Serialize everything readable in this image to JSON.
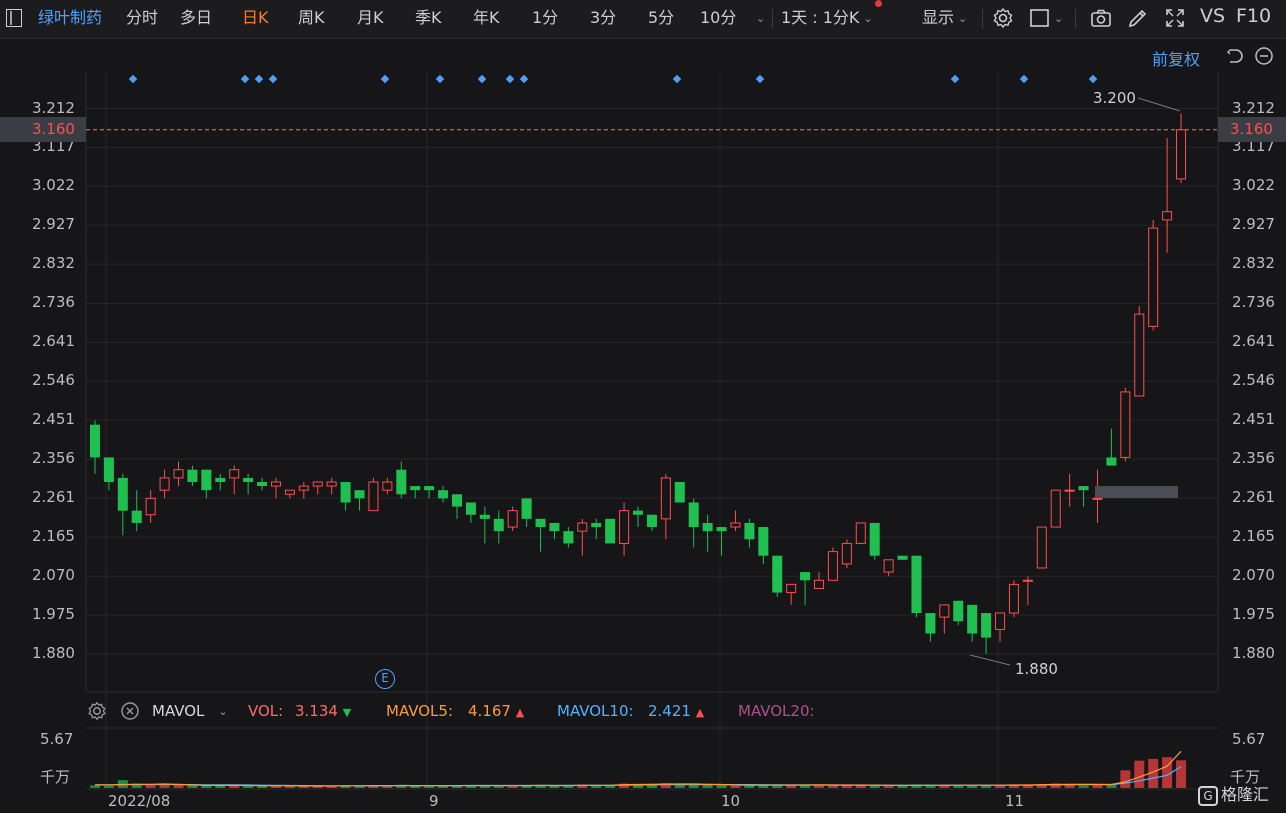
{
  "toolbar": {
    "stock_name": "绿叶制药",
    "tabs": [
      "分时",
      "多日",
      "日K",
      "周K",
      "月K",
      "季K",
      "年K",
      "1分",
      "3分",
      "5分",
      "10分"
    ],
    "active_tab": "日K",
    "period_select": "1天 : 1分K",
    "display_label": "显示",
    "vs_label": "VS",
    "f10_label": "F10",
    "adjust_label": "前复权"
  },
  "price_axis": {
    "ticks": [
      "3.212",
      "3.117",
      "3.022",
      "2.927",
      "2.832",
      "2.736",
      "2.641",
      "2.546",
      "2.451",
      "2.356",
      "2.261",
      "2.165",
      "2.070",
      "1.975",
      "1.880"
    ],
    "current_price": "3.160",
    "high_label": "3.200",
    "low_label": "1.880"
  },
  "volume_indicator": {
    "name": "MAVOL",
    "vol_label": "VOL:",
    "vol_value": "3.134",
    "ma5_label": "MAVOL5:",
    "ma5_value": "4.167",
    "ma10_label": "MAVOL10:",
    "ma10_value": "2.421",
    "ma20_label": "MAVOL20:",
    "axis_top": "5.67",
    "axis_unit": "千万"
  },
  "x_axis": {
    "labels": [
      "2022/08",
      "9",
      "10",
      "11"
    ]
  },
  "event_marker": "E",
  "watermark": "格隆汇",
  "colors": {
    "up": "#ff4d4d",
    "down": "#1fbf50",
    "accent": "#ff7a2f",
    "link": "#4ea0ff",
    "ma5": "#ff9a3c",
    "ma10": "#4fb3ff",
    "ma20": "#b0508a",
    "current_price_line": "#ff7a2f"
  },
  "chart_data": {
    "type": "candlestick",
    "ylim": [
      1.84,
      3.26
    ],
    "candles": [
      {
        "o": 2.44,
        "h": 2.45,
        "l": 2.32,
        "c": 2.36
      },
      {
        "o": 2.36,
        "h": 2.36,
        "l": 2.28,
        "c": 2.3
      },
      {
        "o": 2.31,
        "h": 2.32,
        "l": 2.17,
        "c": 2.23
      },
      {
        "o": 2.23,
        "h": 2.28,
        "l": 2.18,
        "c": 2.2
      },
      {
        "o": 2.22,
        "h": 2.28,
        "l": 2.2,
        "c": 2.26
      },
      {
        "o": 2.28,
        "h": 2.33,
        "l": 2.26,
        "c": 2.31
      },
      {
        "o": 2.31,
        "h": 2.35,
        "l": 2.29,
        "c": 2.33
      },
      {
        "o": 2.33,
        "h": 2.34,
        "l": 2.29,
        "c": 2.3
      },
      {
        "o": 2.33,
        "h": 2.33,
        "l": 2.26,
        "c": 2.28
      },
      {
        "o": 2.31,
        "h": 2.32,
        "l": 2.28,
        "c": 2.3
      },
      {
        "o": 2.31,
        "h": 2.34,
        "l": 2.27,
        "c": 2.33
      },
      {
        "o": 2.31,
        "h": 2.32,
        "l": 2.27,
        "c": 2.3
      },
      {
        "o": 2.3,
        "h": 2.31,
        "l": 2.28,
        "c": 2.29
      },
      {
        "o": 2.29,
        "h": 2.31,
        "l": 2.26,
        "c": 2.3
      },
      {
        "o": 2.27,
        "h": 2.28,
        "l": 2.26,
        "c": 2.28
      },
      {
        "o": 2.28,
        "h": 2.3,
        "l": 2.26,
        "c": 2.29
      },
      {
        "o": 2.29,
        "h": 2.3,
        "l": 2.27,
        "c": 2.3
      },
      {
        "o": 2.29,
        "h": 2.31,
        "l": 2.27,
        "c": 2.3
      },
      {
        "o": 2.3,
        "h": 2.3,
        "l": 2.23,
        "c": 2.25
      },
      {
        "o": 2.28,
        "h": 2.28,
        "l": 2.23,
        "c": 2.26
      },
      {
        "o": 2.23,
        "h": 2.31,
        "l": 2.23,
        "c": 2.3
      },
      {
        "o": 2.28,
        "h": 2.31,
        "l": 2.27,
        "c": 2.3
      },
      {
        "o": 2.33,
        "h": 2.35,
        "l": 2.26,
        "c": 2.27
      },
      {
        "o": 2.29,
        "h": 2.29,
        "l": 2.26,
        "c": 2.28
      },
      {
        "o": 2.29,
        "h": 2.29,
        "l": 2.26,
        "c": 2.28
      },
      {
        "o": 2.28,
        "h": 2.29,
        "l": 2.25,
        "c": 2.26
      },
      {
        "o": 2.27,
        "h": 2.27,
        "l": 2.21,
        "c": 2.24
      },
      {
        "o": 2.25,
        "h": 2.25,
        "l": 2.2,
        "c": 2.22
      },
      {
        "o": 2.22,
        "h": 2.24,
        "l": 2.15,
        "c": 2.21
      },
      {
        "o": 2.21,
        "h": 2.23,
        "l": 2.15,
        "c": 2.18
      },
      {
        "o": 2.19,
        "h": 2.24,
        "l": 2.18,
        "c": 2.23
      },
      {
        "o": 2.26,
        "h": 2.26,
        "l": 2.19,
        "c": 2.21
      },
      {
        "o": 2.21,
        "h": 2.21,
        "l": 2.13,
        "c": 2.19
      },
      {
        "o": 2.2,
        "h": 2.2,
        "l": 2.16,
        "c": 2.18
      },
      {
        "o": 2.18,
        "h": 2.19,
        "l": 2.14,
        "c": 2.15
      },
      {
        "o": 2.18,
        "h": 2.21,
        "l": 2.12,
        "c": 2.2
      },
      {
        "o": 2.2,
        "h": 2.21,
        "l": 2.16,
        "c": 2.19
      },
      {
        "o": 2.21,
        "h": 2.21,
        "l": 2.15,
        "c": 2.15
      },
      {
        "o": 2.15,
        "h": 2.25,
        "l": 2.12,
        "c": 2.23
      },
      {
        "o": 2.23,
        "h": 2.24,
        "l": 2.19,
        "c": 2.22
      },
      {
        "o": 2.22,
        "h": 2.22,
        "l": 2.18,
        "c": 2.19
      },
      {
        "o": 2.21,
        "h": 2.32,
        "l": 2.16,
        "c": 2.31
      },
      {
        "o": 2.3,
        "h": 2.3,
        "l": 2.25,
        "c": 2.25
      },
      {
        "o": 2.25,
        "h": 2.26,
        "l": 2.14,
        "c": 2.19
      },
      {
        "o": 2.2,
        "h": 2.22,
        "l": 2.13,
        "c": 2.18
      },
      {
        "o": 2.19,
        "h": 2.19,
        "l": 2.12,
        "c": 2.18
      },
      {
        "o": 2.19,
        "h": 2.23,
        "l": 2.18,
        "c": 2.2
      },
      {
        "o": 2.2,
        "h": 2.21,
        "l": 2.14,
        "c": 2.16
      },
      {
        "o": 2.19,
        "h": 2.19,
        "l": 2.1,
        "c": 2.12
      },
      {
        "o": 2.12,
        "h": 2.12,
        "l": 2.02,
        "c": 2.03
      },
      {
        "o": 2.03,
        "h": 2.05,
        "l": 2.0,
        "c": 2.05
      },
      {
        "o": 2.08,
        "h": 2.08,
        "l": 2.0,
        "c": 2.06
      },
      {
        "o": 2.04,
        "h": 2.08,
        "l": 2.04,
        "c": 2.06
      },
      {
        "o": 2.06,
        "h": 2.14,
        "l": 2.06,
        "c": 2.13
      },
      {
        "o": 2.1,
        "h": 2.16,
        "l": 2.09,
        "c": 2.15
      },
      {
        "o": 2.15,
        "h": 2.2,
        "l": 2.15,
        "c": 2.2
      },
      {
        "o": 2.2,
        "h": 2.2,
        "l": 2.11,
        "c": 2.12
      },
      {
        "o": 2.08,
        "h": 2.11,
        "l": 2.07,
        "c": 2.11
      },
      {
        "o": 2.12,
        "h": 2.12,
        "l": 2.11,
        "c": 2.11
      },
      {
        "o": 2.12,
        "h": 2.12,
        "l": 1.97,
        "c": 1.98
      },
      {
        "o": 1.98,
        "h": 1.98,
        "l": 1.91,
        "c": 1.93
      },
      {
        "o": 1.97,
        "h": 2.0,
        "l": 1.93,
        "c": 2.0
      },
      {
        "o": 2.01,
        "h": 2.01,
        "l": 1.95,
        "c": 1.96
      },
      {
        "o": 2.0,
        "h": 2.0,
        "l": 1.91,
        "c": 1.93
      },
      {
        "o": 1.98,
        "h": 1.98,
        "l": 1.88,
        "c": 1.92
      },
      {
        "o": 1.94,
        "h": 1.98,
        "l": 1.91,
        "c": 1.98
      },
      {
        "o": 1.98,
        "h": 2.06,
        "l": 1.97,
        "c": 2.05
      },
      {
        "o": 2.06,
        "h": 2.07,
        "l": 2.0,
        "c": 2.06
      },
      {
        "o": 2.09,
        "h": 2.19,
        "l": 2.09,
        "c": 2.19
      },
      {
        "o": 2.19,
        "h": 2.28,
        "l": 2.19,
        "c": 2.28
      },
      {
        "o": 2.28,
        "h": 2.32,
        "l": 2.24,
        "c": 2.28
      },
      {
        "o": 2.29,
        "h": 2.29,
        "l": 2.24,
        "c": 2.28
      },
      {
        "o": 2.26,
        "h": 2.33,
        "l": 2.2,
        "c": 2.26
      },
      {
        "o": 2.36,
        "h": 2.43,
        "l": 2.35,
        "c": 2.34
      },
      {
        "o": 2.36,
        "h": 2.53,
        "l": 2.35,
        "c": 2.52
      },
      {
        "o": 2.51,
        "h": 2.73,
        "l": 2.51,
        "c": 2.71
      },
      {
        "o": 2.68,
        "h": 2.94,
        "l": 2.67,
        "c": 2.92
      },
      {
        "o": 2.94,
        "h": 3.14,
        "l": 2.86,
        "c": 2.96
      },
      {
        "o": 3.04,
        "h": 3.2,
        "l": 3.03,
        "c": 3.16
      }
    ],
    "volume": {
      "ylim": [
        0,
        5.67
      ],
      "unit": "千万",
      "values": [
        0.3,
        0.25,
        0.9,
        0.5,
        0.3,
        0.35,
        0.4,
        0.3,
        0.25,
        0.3,
        0.3,
        0.25,
        0.2,
        0.25,
        0.2,
        0.2,
        0.25,
        0.25,
        0.3,
        0.25,
        0.3,
        0.2,
        0.35,
        0.25,
        0.2,
        0.25,
        0.3,
        0.3,
        0.25,
        0.3,
        0.25,
        0.3,
        0.3,
        0.25,
        0.3,
        0.4,
        0.3,
        0.35,
        0.5,
        0.45,
        0.35,
        0.55,
        0.4,
        0.4,
        0.35,
        0.3,
        0.25,
        0.35,
        0.35,
        0.4,
        0.3,
        0.3,
        0.35,
        0.3,
        0.35,
        0.35,
        0.3,
        0.25,
        0.25,
        0.4,
        0.35,
        0.3,
        0.3,
        0.35,
        0.3,
        0.3,
        0.4,
        0.35,
        0.45,
        0.5,
        0.35,
        0.3,
        0.35,
        0.45,
        2.0,
        3.1,
        3.3,
        3.5,
        3.134
      ],
      "ma5": [
        0.35,
        0.35,
        0.4,
        0.42,
        0.42,
        0.45,
        0.4,
        0.35,
        0.3,
        0.3,
        0.3,
        0.28,
        0.25,
        0.25,
        0.25,
        0.24,
        0.23,
        0.23,
        0.25,
        0.25,
        0.27,
        0.26,
        0.28,
        0.27,
        0.26,
        0.26,
        0.27,
        0.28,
        0.28,
        0.28,
        0.28,
        0.28,
        0.29,
        0.28,
        0.28,
        0.31,
        0.31,
        0.32,
        0.37,
        0.4,
        0.41,
        0.44,
        0.45,
        0.45,
        0.41,
        0.4,
        0.34,
        0.33,
        0.32,
        0.33,
        0.33,
        0.34,
        0.35,
        0.34,
        0.33,
        0.33,
        0.33,
        0.31,
        0.29,
        0.31,
        0.31,
        0.31,
        0.32,
        0.32,
        0.32,
        0.32,
        0.34,
        0.34,
        0.37,
        0.4,
        0.41,
        0.41,
        0.41,
        0.4,
        0.69,
        1.24,
        1.83,
        2.47,
        4.167
      ],
      "ma10": [
        0.35,
        0.34,
        0.37,
        0.38,
        0.38,
        0.4,
        0.4,
        0.38,
        0.36,
        0.36,
        0.35,
        0.34,
        0.32,
        0.3,
        0.28,
        0.27,
        0.26,
        0.25,
        0.25,
        0.25,
        0.25,
        0.25,
        0.26,
        0.26,
        0.26,
        0.26,
        0.27,
        0.27,
        0.27,
        0.27,
        0.27,
        0.27,
        0.28,
        0.28,
        0.28,
        0.29,
        0.3,
        0.3,
        0.32,
        0.34,
        0.35,
        0.37,
        0.38,
        0.39,
        0.39,
        0.39,
        0.38,
        0.38,
        0.37,
        0.36,
        0.35,
        0.34,
        0.34,
        0.34,
        0.34,
        0.34,
        0.33,
        0.32,
        0.31,
        0.32,
        0.32,
        0.32,
        0.32,
        0.32,
        0.32,
        0.32,
        0.33,
        0.33,
        0.34,
        0.35,
        0.36,
        0.37,
        0.38,
        0.39,
        0.54,
        0.82,
        1.12,
        1.44,
        2.421
      ]
    }
  }
}
